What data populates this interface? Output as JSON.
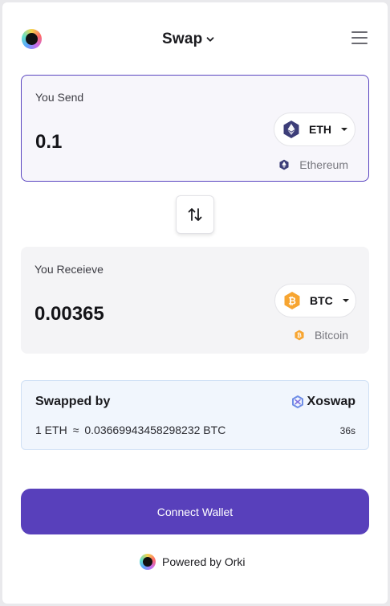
{
  "header": {
    "title": "Swap",
    "logo_icon": "orki-logo-icon",
    "menu_icon": "hamburger-menu-icon"
  },
  "send": {
    "label": "You Send",
    "amount": "0.1",
    "token": {
      "symbol": "ETH",
      "icon": "ethereum-icon"
    },
    "network": {
      "name": "Ethereum",
      "icon": "ethereum-icon"
    }
  },
  "swap_direction_icon": "swap-arrows-icon",
  "receive": {
    "label": "You Receieve",
    "amount": "0.00365",
    "token": {
      "symbol": "BTC",
      "icon": "bitcoin-icon"
    },
    "network": {
      "name": "Bitcoin",
      "icon": "bitcoin-icon"
    }
  },
  "route": {
    "label": "Swapped by",
    "provider": "Xoswap",
    "rate_from": "1 ETH",
    "approx": "≈",
    "rate_to": "0.03669943458298232 BTC",
    "timer": "36s"
  },
  "actions": {
    "connect_label": "Connect Wallet"
  },
  "footer": {
    "powered_by": "Powered by Orki"
  },
  "colors": {
    "accent": "#5840bb",
    "eth": "#3c3d78",
    "btc": "#f7a531",
    "route_bg": "#f1f6fd"
  }
}
